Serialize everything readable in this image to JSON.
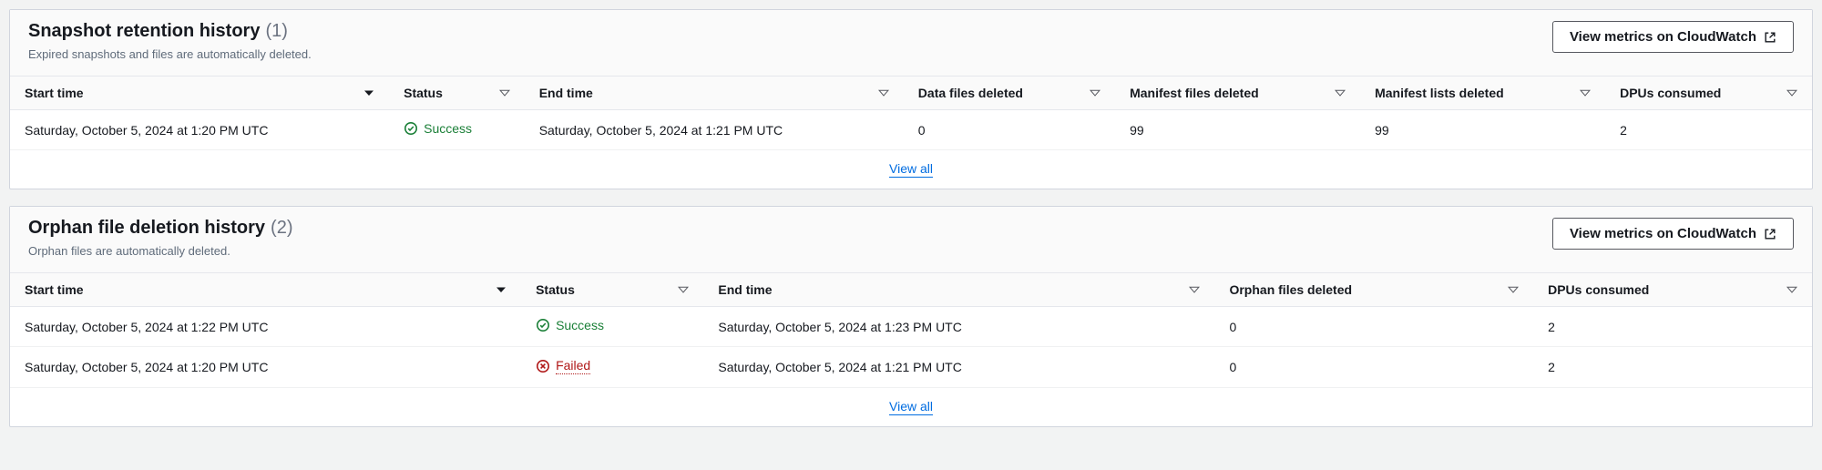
{
  "panels": [
    {
      "id": "snapshot",
      "title": "Snapshot retention history",
      "count_label": "(1)",
      "subtitle": "Expired snapshots and files are automatically deleted.",
      "button_label": "View metrics on CloudWatch",
      "view_all_label": "View all",
      "columns": [
        {
          "label": "Start time",
          "sorted": true
        },
        {
          "label": "Status"
        },
        {
          "label": "End time"
        },
        {
          "label": "Data files deleted"
        },
        {
          "label": "Manifest files deleted"
        },
        {
          "label": "Manifest lists deleted"
        },
        {
          "label": "DPUs consumed"
        }
      ],
      "rows": [
        {
          "start": "Saturday, October 5, 2024 at 1:20 PM UTC",
          "status": {
            "state": "success",
            "label": "Success"
          },
          "end": "Saturday, October 5, 2024 at 1:21 PM UTC",
          "v1": "0",
          "v2": "99",
          "v3": "99",
          "v4": "2"
        }
      ]
    },
    {
      "id": "orphan",
      "title": "Orphan file deletion history",
      "count_label": "(2)",
      "subtitle": "Orphan files are automatically deleted.",
      "button_label": "View metrics on CloudWatch",
      "view_all_label": "View all",
      "columns": [
        {
          "label": "Start time",
          "sorted": true
        },
        {
          "label": "Status"
        },
        {
          "label": "End time"
        },
        {
          "label": "Orphan files deleted"
        },
        {
          "label": "DPUs consumed"
        }
      ],
      "rows": [
        {
          "start": "Saturday, October 5, 2024 at 1:22 PM UTC",
          "status": {
            "state": "success",
            "label": "Success"
          },
          "end": "Saturday, October 5, 2024 at 1:23 PM UTC",
          "v1": "0",
          "v2": "2"
        },
        {
          "start": "Saturday, October 5, 2024 at 1:20 PM UTC",
          "status": {
            "state": "failed",
            "label": "Failed"
          },
          "end": "Saturday, October 5, 2024 at 1:21 PM UTC",
          "v1": "0",
          "v2": "2"
        }
      ]
    }
  ]
}
